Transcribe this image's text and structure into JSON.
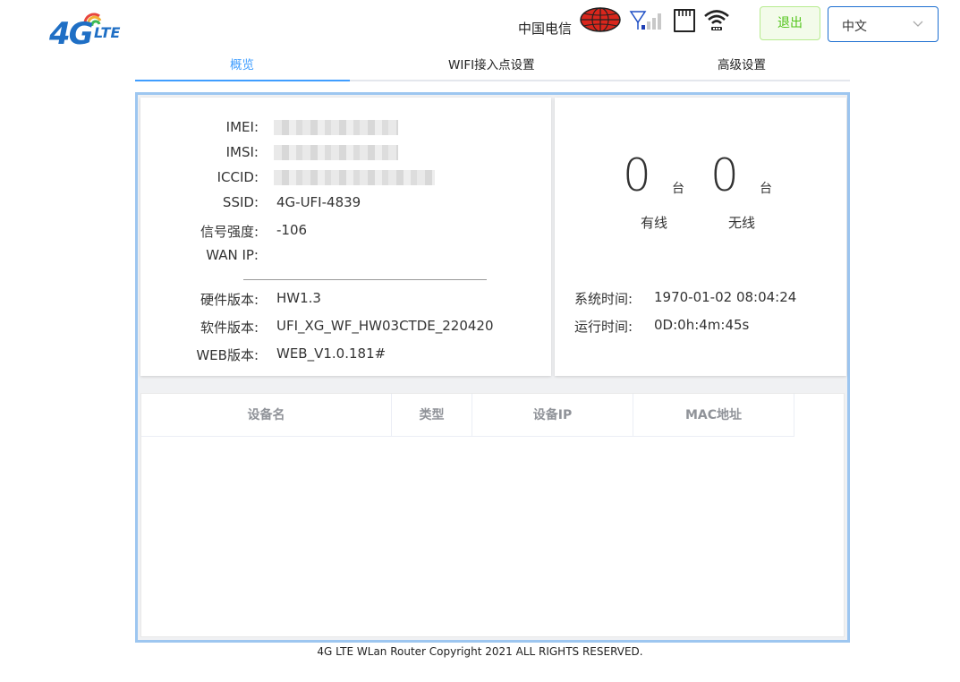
{
  "header": {
    "logo_main": "4G",
    "logo_sub": "LTE",
    "carrier": "中国电信",
    "logout_label": "退出",
    "language": "中文",
    "icons": [
      "globe-icon",
      "signal-icon",
      "sd-card-icon",
      "wifi-icon"
    ]
  },
  "tabs": [
    {
      "label": "概览",
      "active": true
    },
    {
      "label": "WIFI接入点设置",
      "active": false
    },
    {
      "label": "高级设置",
      "active": false
    }
  ],
  "device_info": {
    "imei_label": "IMEI:",
    "imsi_label": "IMSI:",
    "iccid_label": "ICCID:",
    "ssid_label": "SSID:",
    "ssid_value": "4G-UFI-4839",
    "signal_label": "信号强度:",
    "signal_value": "-106",
    "wan_label": "WAN IP:",
    "wan_value": "",
    "hw_label": "硬件版本:",
    "hw_value": "HW1.3",
    "sw_label": "软件版本:",
    "sw_value": "UFI_XG_WF_HW03CTDE_220420",
    "web_label": "WEB版本:",
    "web_value": "WEB_V1.0.181#"
  },
  "clients": {
    "wired_count": "0",
    "wireless_count": "0",
    "unit": "台",
    "wired_label": "有线",
    "wireless_label": "无线"
  },
  "system": {
    "time_label": "系统时间:",
    "time_value": "1970-01-02 08:04:24",
    "uptime_label": "运行时间:",
    "uptime_value": "0D:0h:4m:45s"
  },
  "device_table": {
    "columns": [
      "设备名",
      "类型",
      "设备IP",
      "MAC地址"
    ],
    "rows": []
  },
  "footer": "4G LTE WLan Router Copyright 2021 ALL RIGHTS RESERVED.",
  "colors": {
    "accent": "#409eff",
    "logo": "#1f6fc5",
    "logout_green": "#52c41a",
    "panel_border": "#9dc6f0",
    "globe_red": "#d9261c"
  }
}
